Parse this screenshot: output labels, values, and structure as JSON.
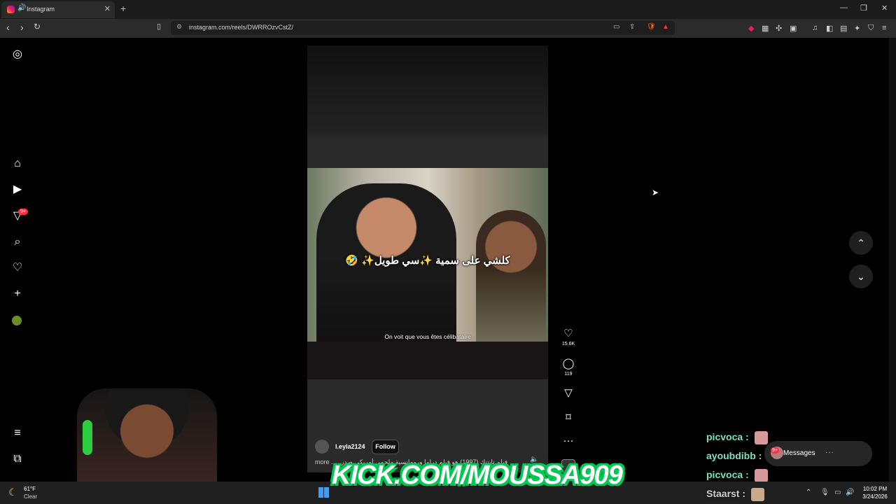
{
  "browser": {
    "tab_title": "Instagram",
    "new_tab": "+",
    "url": "instagram.com/reels/DWRROzvCstZ/"
  },
  "sidebar": {
    "notifications_badge": "9+"
  },
  "reel": {
    "caption_arabic": "كلشي على سمية ✨سي طويل✨ 🤣",
    "caption_french": "On voit que vous êtes célibataire",
    "author": "l.eyla2124",
    "follow_label": "Follow",
    "description": "فيلم تايتنك (1997) هو فيلم دراما ورومانسية ملحمي أمريكي صدر",
    "more_label": "more ...",
    "likes": "15.6K",
    "comments": "119"
  },
  "chat": [
    {
      "user": "picvoca :",
      "color": "#7fe0c0"
    },
    {
      "user": "ayoubdibb :",
      "color": "#7fe0c0"
    },
    {
      "user": "picvoca :",
      "color": "#7fe0c0"
    },
    {
      "user": "Staarst :",
      "color": "#d0d0d0"
    }
  ],
  "messages": {
    "label": "Messages",
    "badge": "9+",
    "dots": "···"
  },
  "overlay": {
    "kick_text": "KICK.COM/MOUSSA909"
  },
  "taskbar": {
    "temperature": "61°F",
    "condition": "Clear",
    "time": "10:02 PM",
    "date": "3/24/2026"
  }
}
